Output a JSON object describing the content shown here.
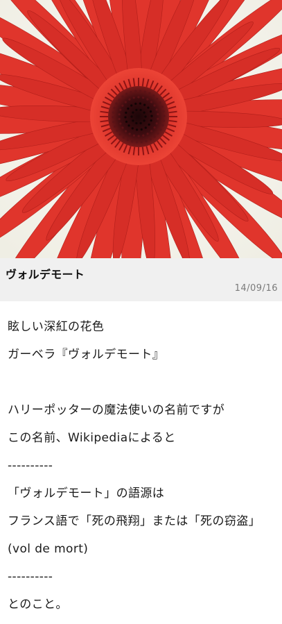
{
  "post": {
    "title": "ヴォルデモート",
    "date": "14/09/16",
    "image_alt": "red gerbera flower"
  },
  "body_lines": [
    "眩しい深紅の花色",
    "ガーベラ『ヴォルデモート』",
    "",
    "ハリーポッターの魔法使いの名前ですが",
    "この名前、Wikipediaによると",
    "----------",
    "「ヴォルデモート」の語源は",
    "フランス語で「死の飛翔」または「死の窃盗」",
    "(vol de mort)",
    "----------",
    "とのこと。"
  ],
  "colors": {
    "petal": "#e0352c",
    "petal_dark": "#b51d1a",
    "center": "#3a0d10",
    "stem": "#6fa23a",
    "background": "#f7f6ef",
    "caption_bar": "#f0f0f0",
    "date_text": "#7a7a7a"
  }
}
